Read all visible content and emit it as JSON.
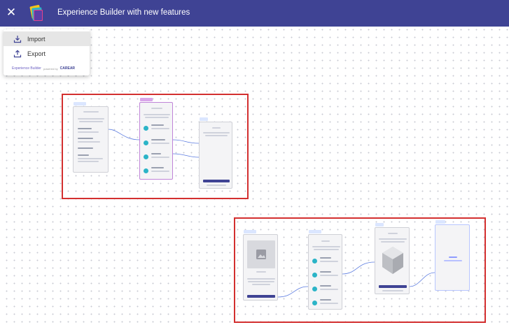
{
  "header": {
    "title": "Experience Builder with new features",
    "background": "#3f4394",
    "close_icon": "close-icon",
    "logo_icon": "app-logo-icon"
  },
  "menu": {
    "items": [
      {
        "label": "Import",
        "icon": "import-icon"
      },
      {
        "label": "Export",
        "icon": "export-icon"
      }
    ],
    "powered_by": {
      "product": "Experience Builder",
      "text": "powered by",
      "brand": "CAREAR"
    }
  },
  "colors": {
    "frame_border": "#d32f2f",
    "accent": "#2bb4c7",
    "connector": "#5b7be0"
  }
}
